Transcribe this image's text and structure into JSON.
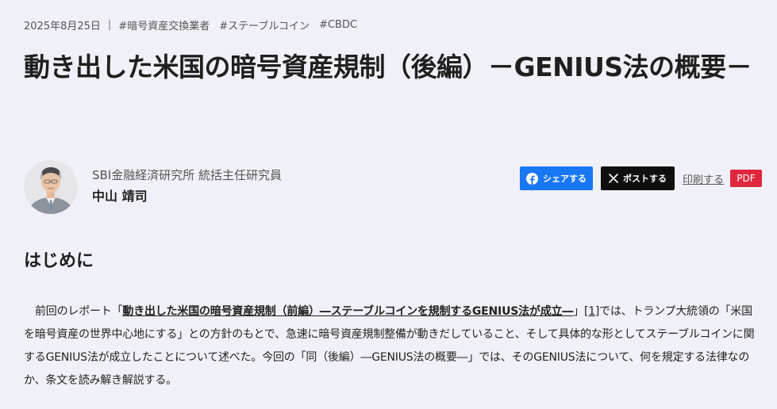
{
  "meta": {
    "date": "2025年8月25日",
    "separator": "|",
    "tags": [
      "#暗号資産交換業者",
      "#ステーブルコイン",
      "#CBDC"
    ]
  },
  "article": {
    "title": "動き出した米国の暗号資産規制（後編）－GENIUS法の概要－"
  },
  "author": {
    "affiliation": "SBI金融経済研究所 統括主任研究員",
    "name": "中山 靖司"
  },
  "share": {
    "facebook_label": "シェアする",
    "x_label": "ポストする",
    "print_label": "印刷する",
    "pdf_label": "PDF",
    "facebook_color": "#1877f2",
    "x_color": "#0f0f0f",
    "pdf_color": "#e0263e"
  },
  "section": {
    "heading": "はじめに"
  },
  "paragraph": {
    "lead": "前回のレポート「",
    "link_text": "動き出した米国の暗号資産規制（前編）―ステーブルコインを規制するGENIUS法が成立―",
    "close_quote": "」",
    "ref": "[1]",
    "rest": "では、トランプ大統領の「米国を暗号資産の世界中心地にする」との方針のもとで、急速に暗号資産規制整備が動きだしていること、そして具体的な形としてステーブルコインに関するGENIUS法が成立したことについて述べた。今回の「同（後編）―GENIUS法の概要―」では、そのGENIUS法について、何を規定する法律なのか、条文を読み解き解説する。"
  }
}
